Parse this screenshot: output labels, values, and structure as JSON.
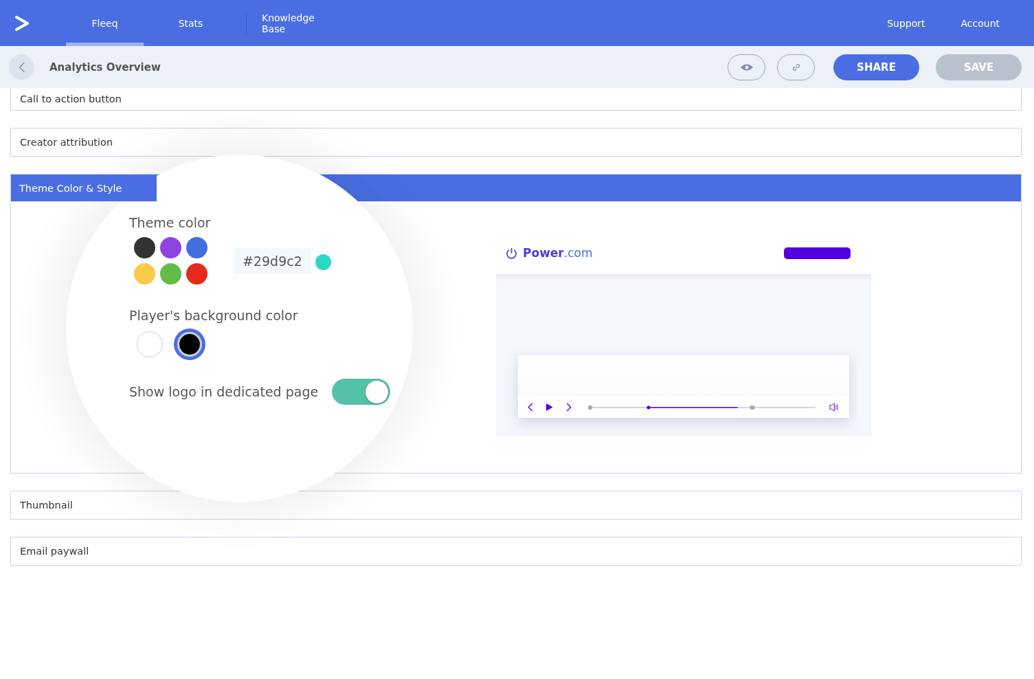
{
  "nav": {
    "tabs": [
      {
        "label": "Fleeq",
        "selected": true
      },
      {
        "label": "Stats",
        "selected": false
      },
      {
        "label": "Knowledge Base",
        "selected": false
      }
    ],
    "right_links": [
      "Support",
      "Account"
    ]
  },
  "toolbar": {
    "title": "Analytics Overview",
    "share_label": "SHARE",
    "save_label": "SAVE",
    "save_disabled": true
  },
  "sections_before": [
    {
      "title": "Call to action button"
    },
    {
      "title": "Creator attribution"
    }
  ],
  "theme_section": {
    "title": "Theme Color & Style",
    "theme_color_label": "Theme color",
    "swatches": [
      {
        "color": "#333333",
        "selected": false
      },
      {
        "color": "#8e44e0",
        "selected": false
      },
      {
        "color": "#436ee0",
        "selected": false
      },
      {
        "color": "#fdc94a",
        "selected": false
      },
      {
        "color": "#62bd46",
        "selected": false
      },
      {
        "color": "#e52a1b",
        "selected": false
      }
    ],
    "hex_value": "#29d9c2",
    "background_label": "Player's background color",
    "backgrounds": [
      {
        "color": "#ffffff",
        "selected": false
      },
      {
        "color": "#000000",
        "selected": true
      }
    ],
    "logo_label": "Show logo in dedicated page",
    "logo_on": true,
    "preview": {
      "brand_bold": "Power",
      "brand_rest": ".com"
    }
  },
  "sections_after": [
    {
      "title": "Thumbnail"
    },
    {
      "title": "Email paywall"
    }
  ]
}
